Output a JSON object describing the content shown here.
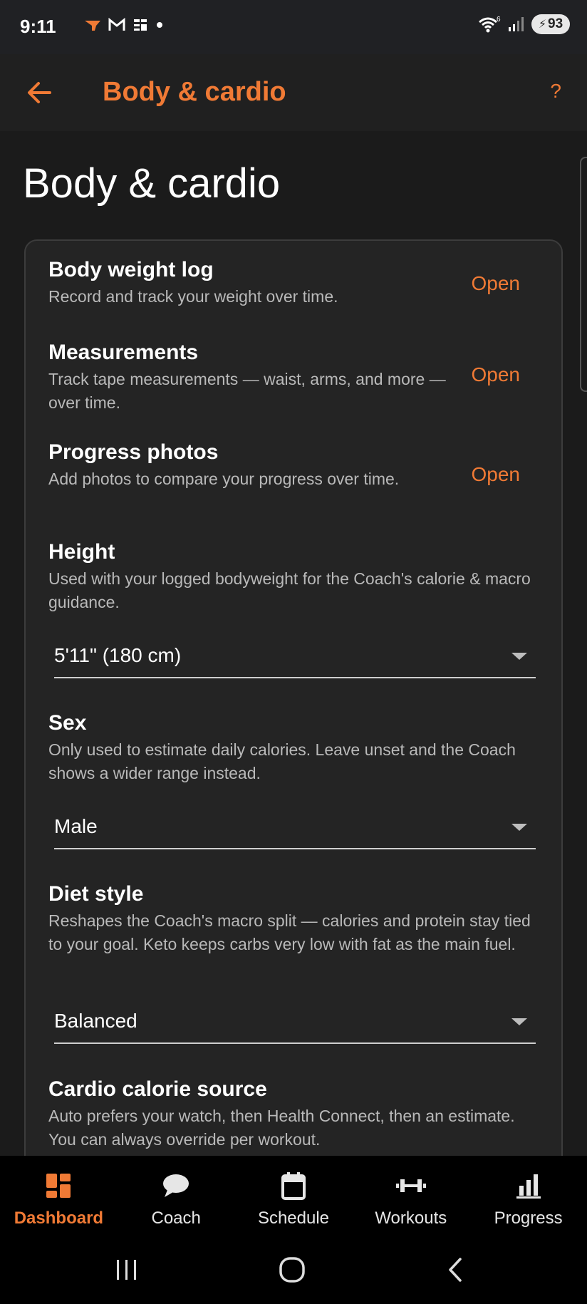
{
  "status_bar": {
    "time": "9:11",
    "battery": "93",
    "wifi_label": "6"
  },
  "app_bar": {
    "title": "Body & cardio",
    "help": "?"
  },
  "page": {
    "title": "Body & cardio"
  },
  "items": [
    {
      "title": "Body weight log",
      "desc": "Record and track your weight over time.",
      "action": "Open"
    },
    {
      "title": "Measurements",
      "desc": "Track tape measurements — waist, arms, and more — over time.",
      "action": "Open"
    },
    {
      "title": "Progress photos",
      "desc": "Add photos to compare your progress over time.",
      "action": "Open"
    }
  ],
  "height": {
    "title": "Height",
    "desc": "Used with your logged bodyweight for the Coach's calorie & macro guidance.",
    "value": "5'11\" (180 cm)"
  },
  "sex": {
    "title": "Sex",
    "desc": "Only used to estimate daily calories. Leave unset and the Coach shows a wider range instead.",
    "value": "Male"
  },
  "diet": {
    "title": "Diet style",
    "desc": "Reshapes the Coach's macro split — calories and protein stay tied to your goal. Keto keeps carbs very low with fat as the main fuel.",
    "value": "Balanced"
  },
  "cardio": {
    "title": "Cardio calorie source",
    "desc": "Auto prefers your watch, then Health Connect, then an estimate. You can always override per workout."
  },
  "bottom_nav": [
    {
      "label": "Dashboard",
      "icon": "dashboard-icon",
      "active": true
    },
    {
      "label": "Coach",
      "icon": "chat-bubble-icon",
      "active": false
    },
    {
      "label": "Schedule",
      "icon": "calendar-icon",
      "active": false
    },
    {
      "label": "Workouts",
      "icon": "dumbbell-icon",
      "active": false
    },
    {
      "label": "Progress",
      "icon": "bar-chart-icon",
      "active": false
    }
  ],
  "colors": {
    "accent": "#f07a35",
    "background": "#1b1b1b",
    "card": "#242424"
  }
}
